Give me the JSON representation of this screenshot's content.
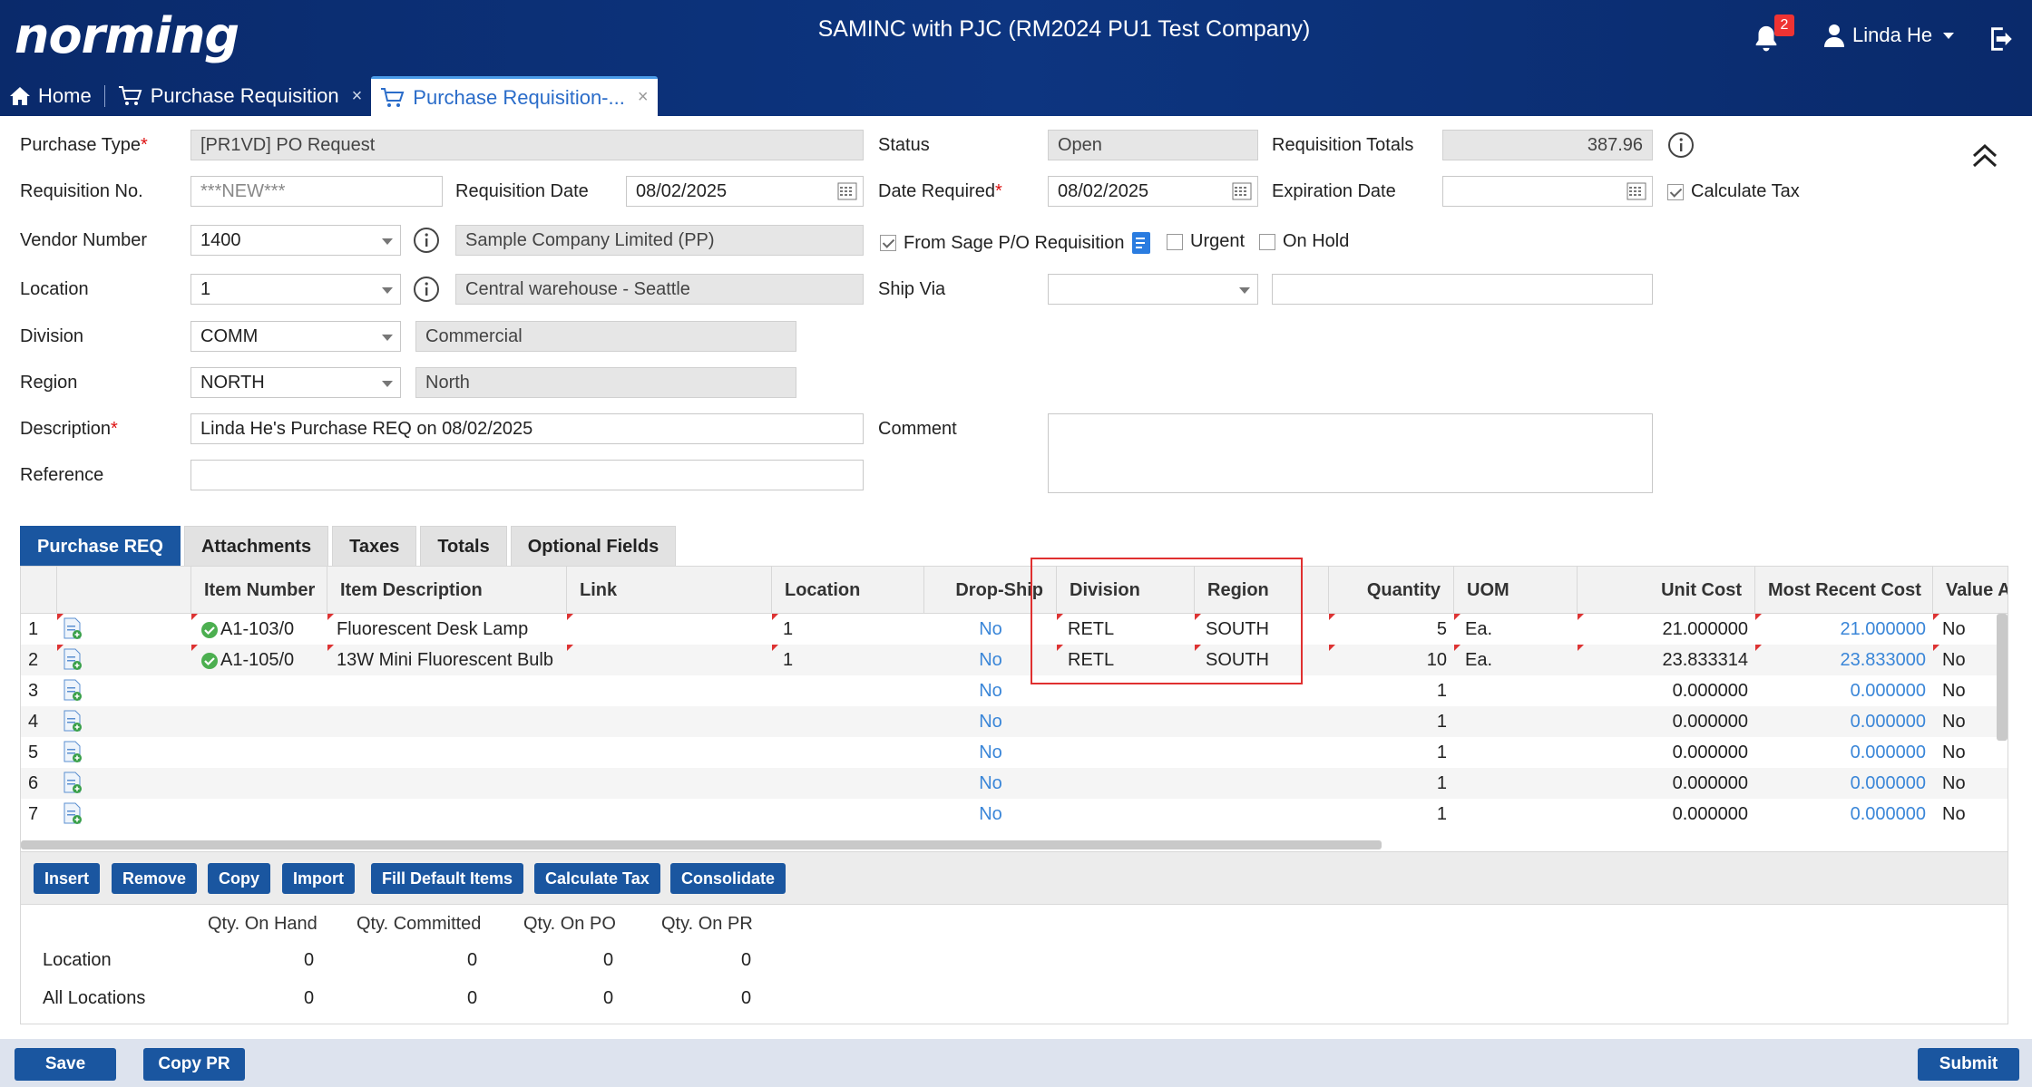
{
  "header": {
    "logo": "norming",
    "company": "SAMINC with PJC (RM2024 PU1 Test Company)",
    "notification_count": "2",
    "user_name": "Linda He"
  },
  "tabs": [
    {
      "label": "Home"
    },
    {
      "label": "Purchase Requisition"
    },
    {
      "label": "Purchase Requisition-..."
    }
  ],
  "form": {
    "purchase_type": {
      "label": "Purchase Type",
      "value": "[PR1VD] PO Request"
    },
    "status": {
      "label": "Status",
      "value": "Open"
    },
    "requisition_totals": {
      "label": "Requisition Totals",
      "value": "387.96"
    },
    "requisition_no": {
      "label": "Requisition No.",
      "value": "***NEW***"
    },
    "requisition_date": {
      "label": "Requisition Date",
      "value": "08/02/2025"
    },
    "date_required": {
      "label": "Date Required",
      "value": "08/02/2025"
    },
    "expiration_date": {
      "label": "Expiration Date",
      "value": ""
    },
    "calculate_tax": {
      "label": "Calculate Tax",
      "checked": true
    },
    "vendor_number": {
      "label": "Vendor Number",
      "value": "1400",
      "desc": "Sample Company Limited (PP)"
    },
    "from_sage": {
      "label": "From Sage P/O Requisition",
      "checked": true
    },
    "urgent": {
      "label": "Urgent",
      "checked": false
    },
    "on_hold": {
      "label": "On Hold",
      "checked": false
    },
    "location": {
      "label": "Location",
      "value": "1",
      "desc": "Central warehouse - Seattle"
    },
    "ship_via": {
      "label": "Ship Via",
      "value": "",
      "desc": ""
    },
    "division": {
      "label": "Division",
      "value": "COMM",
      "desc": "Commercial"
    },
    "region": {
      "label": "Region",
      "value": "NORTH",
      "desc": "North"
    },
    "description": {
      "label": "Description",
      "value": "Linda He's Purchase REQ on 08/02/2025"
    },
    "comment": {
      "label": "Comment",
      "value": ""
    },
    "reference": {
      "label": "Reference",
      "value": ""
    }
  },
  "detail_tabs": [
    {
      "label": "Purchase REQ"
    },
    {
      "label": "Attachments"
    },
    {
      "label": "Taxes"
    },
    {
      "label": "Totals"
    },
    {
      "label": "Optional Fields"
    }
  ],
  "grid": {
    "columns": [
      "Item Number",
      "Item Description",
      "Link",
      "Location",
      "Drop-Ship",
      "Division",
      "Region",
      "Quantity",
      "UOM",
      "Unit Cost",
      "Most Recent Cost",
      "Value Add"
    ],
    "rows": [
      {
        "n": "1",
        "item": "A1-103/0",
        "desc": "Fluorescent Desk Lamp",
        "link": "",
        "loc": "1",
        "drop": "No",
        "div": "RETL",
        "reg": "SOUTH",
        "qty": "5",
        "uom": "Ea.",
        "unit": "21.000000",
        "recent": "21.000000",
        "va": "No"
      },
      {
        "n": "2",
        "item": "A1-105/0",
        "desc": "13W Mini Fluorescent Bulb",
        "link": "",
        "loc": "1",
        "drop": "No",
        "div": "RETL",
        "reg": "SOUTH",
        "qty": "10",
        "uom": "Ea.",
        "unit": "23.833314",
        "recent": "23.833000",
        "va": "No"
      },
      {
        "n": "3",
        "item": "",
        "desc": "",
        "link": "",
        "loc": "",
        "drop": "No",
        "div": "",
        "reg": "",
        "qty": "1",
        "uom": "",
        "unit": "0.000000",
        "recent": "0.000000",
        "va": "No"
      },
      {
        "n": "4",
        "item": "",
        "desc": "",
        "link": "",
        "loc": "",
        "drop": "No",
        "div": "",
        "reg": "",
        "qty": "1",
        "uom": "",
        "unit": "0.000000",
        "recent": "0.000000",
        "va": "No"
      },
      {
        "n": "5",
        "item": "",
        "desc": "",
        "link": "",
        "loc": "",
        "drop": "No",
        "div": "",
        "reg": "",
        "qty": "1",
        "uom": "",
        "unit": "0.000000",
        "recent": "0.000000",
        "va": "No"
      },
      {
        "n": "6",
        "item": "",
        "desc": "",
        "link": "",
        "loc": "",
        "drop": "No",
        "div": "",
        "reg": "",
        "qty": "1",
        "uom": "",
        "unit": "0.000000",
        "recent": "0.000000",
        "va": "No"
      },
      {
        "n": "7",
        "item": "",
        "desc": "",
        "link": "",
        "loc": "",
        "drop": "No",
        "div": "",
        "reg": "",
        "qty": "1",
        "uom": "",
        "unit": "0.000000",
        "recent": "0.000000",
        "va": "No"
      }
    ]
  },
  "actions": [
    "Insert",
    "Remove",
    "Copy",
    "Import",
    "Fill Default Items",
    "Calculate Tax",
    "Consolidate"
  ],
  "qty": {
    "headers": [
      "Qty. On Hand",
      "Qty. Committed",
      "Qty. On PO",
      "Qty. On PR"
    ],
    "rows": [
      {
        "label": "Location",
        "values": [
          "0",
          "0",
          "0",
          "0"
        ]
      },
      {
        "label": "All Locations",
        "values": [
          "0",
          "0",
          "0",
          "0"
        ]
      }
    ]
  },
  "footer": {
    "save": "Save",
    "copy_pr": "Copy PR",
    "submit": "Submit"
  },
  "colors": {
    "header_bg": "#0a2a6b",
    "accent": "#1a56a0",
    "link": "#3a86d8",
    "highlight": "#e03030"
  }
}
